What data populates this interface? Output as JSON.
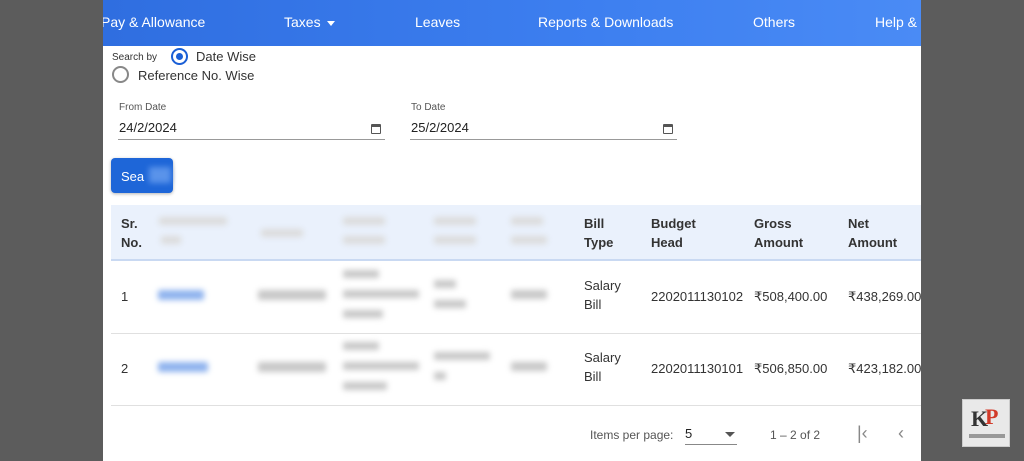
{
  "nav": {
    "items": [
      "Pay & Allowance",
      "Taxes",
      "Leaves",
      "Reports & Downloads",
      "Others",
      "Help & S"
    ]
  },
  "search": {
    "label": "Search by",
    "options": [
      "Date Wise",
      "Reference No. Wise"
    ],
    "selected": "Date Wise",
    "from_label": "From Date",
    "from_value": "24/2/2024",
    "to_label": "To Date",
    "to_value": "25/2/2024",
    "button_label": "Sea"
  },
  "table": {
    "headers": {
      "sr_no": [
        "Sr.",
        "No."
      ],
      "bill_type": [
        "Bill",
        "Type"
      ],
      "budget_head": [
        "Budget",
        "Head"
      ],
      "gross_amount": [
        "Gross",
        "Amount"
      ],
      "net_amount": [
        "Net",
        "Amount"
      ]
    },
    "rows": [
      {
        "sr": "1",
        "bill_type": [
          "Salary",
          "Bill"
        ],
        "budget_head": "2202011130102",
        "gross": "₹508,400.00",
        "net": "₹438,269.00"
      },
      {
        "sr": "2",
        "bill_type": [
          "Salary",
          "Bill"
        ],
        "budget_head": "2202011130101",
        "gross": "₹506,850.00",
        "net": "₹423,182.00"
      }
    ]
  },
  "pager": {
    "items_per_page_label": "Items per page:",
    "items_per_page_value": "5",
    "range": "1 – 2 of 2"
  },
  "logo": {
    "text_k": "K",
    "text_p": "P"
  },
  "colors": {
    "nav": "#3d7ff0",
    "accent": "#1e66d8"
  }
}
